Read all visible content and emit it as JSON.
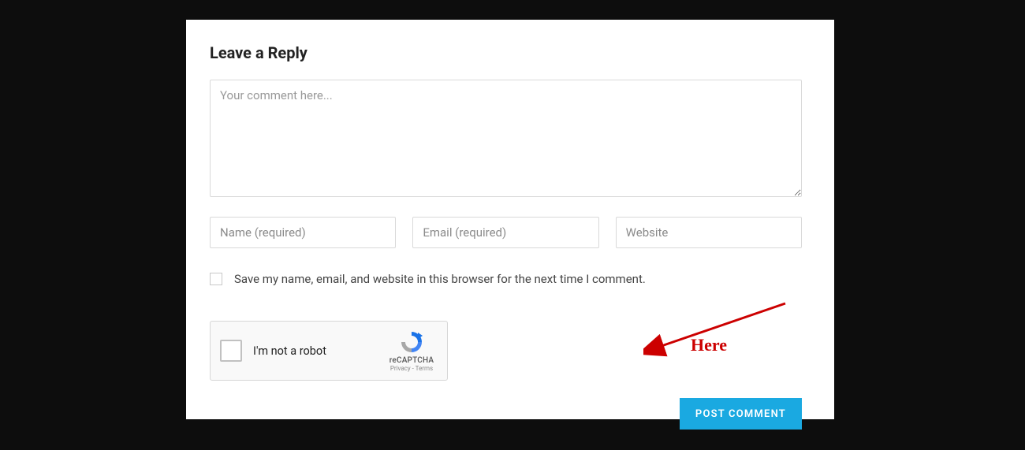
{
  "heading": "Leave a Reply",
  "comment": {
    "placeholder": "Your comment here...",
    "value": ""
  },
  "fields": {
    "name": {
      "placeholder": "Name (required)",
      "value": ""
    },
    "email": {
      "placeholder": "Email (required)",
      "value": ""
    },
    "website": {
      "placeholder": "Website",
      "value": ""
    }
  },
  "save_checkbox": {
    "checked": false,
    "label": "Save my name, email, and website in this browser for the next time I comment."
  },
  "recaptcha": {
    "label": "I'm not a robot",
    "brand": "reCAPTCHA",
    "links": "Privacy - Terms"
  },
  "submit_label": "POST COMMENT",
  "annotation": {
    "text": "Here",
    "color": "#cc0000"
  }
}
